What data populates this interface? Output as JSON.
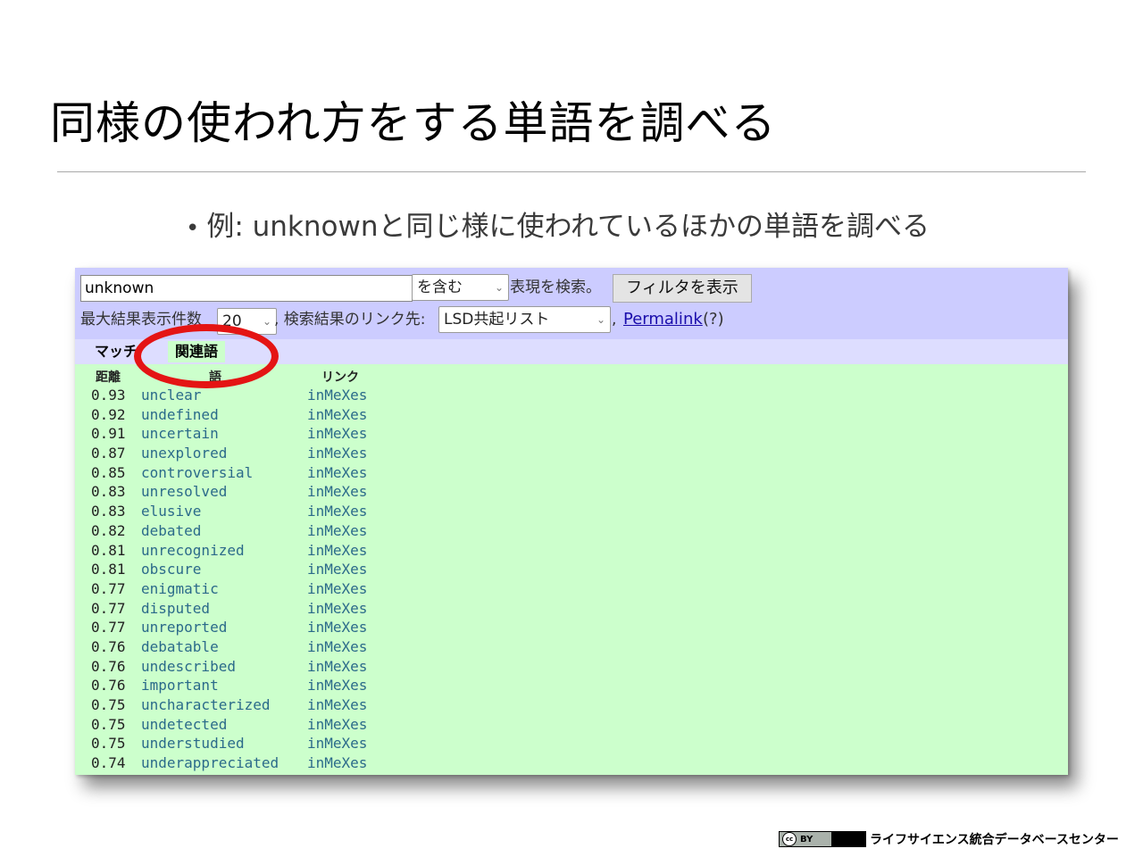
{
  "slide": {
    "title": "同様の使われ方をする単語を調べる",
    "bullet_dot": "•",
    "bullet": "例: unknownと同じ様に使われているほかの単語を調べる"
  },
  "toolbar": {
    "search_value": "unknown",
    "match_mode": "を含む",
    "search_suffix": "表現を検索。",
    "filter_button": "フィルタを表示",
    "max_results_label": "最大結果表示件数",
    "max_results_value": "20",
    "link_target_label": ", 検索結果のリンク先:",
    "link_target_value": "LSD共起リスト",
    "comma": ",",
    "permalink": "Permalink",
    "help": "(?)"
  },
  "tabs": {
    "match": "マッチ",
    "related": "関連語"
  },
  "results": {
    "headers": {
      "distance": "距離",
      "word": "語",
      "link": "リンク"
    },
    "rows": [
      {
        "score": "0.93",
        "word": "unclear",
        "link": "inMeXes"
      },
      {
        "score": "0.92",
        "word": "undefined",
        "link": "inMeXes"
      },
      {
        "score": "0.91",
        "word": "uncertain",
        "link": "inMeXes"
      },
      {
        "score": "0.87",
        "word": "unexplored",
        "link": "inMeXes"
      },
      {
        "score": "0.85",
        "word": "controversial",
        "link": "inMeXes"
      },
      {
        "score": "0.83",
        "word": "unresolved",
        "link": "inMeXes"
      },
      {
        "score": "0.83",
        "word": "elusive",
        "link": "inMeXes"
      },
      {
        "score": "0.82",
        "word": "debated",
        "link": "inMeXes"
      },
      {
        "score": "0.81",
        "word": "unrecognized",
        "link": "inMeXes"
      },
      {
        "score": "0.81",
        "word": "obscure",
        "link": "inMeXes"
      },
      {
        "score": "0.77",
        "word": "enigmatic",
        "link": "inMeXes"
      },
      {
        "score": "0.77",
        "word": "disputed",
        "link": "inMeXes"
      },
      {
        "score": "0.77",
        "word": "unreported",
        "link": "inMeXes"
      },
      {
        "score": "0.76",
        "word": "debatable",
        "link": "inMeXes"
      },
      {
        "score": "0.76",
        "word": "undescribed",
        "link": "inMeXes"
      },
      {
        "score": "0.76",
        "word": "important",
        "link": "inMeXes"
      },
      {
        "score": "0.75",
        "word": "uncharacterized",
        "link": "inMeXes"
      },
      {
        "score": "0.75",
        "word": "undetected",
        "link": "inMeXes"
      },
      {
        "score": "0.75",
        "word": "understudied",
        "link": "inMeXes"
      },
      {
        "score": "0.74",
        "word": "underappreciated",
        "link": "inMeXes"
      }
    ]
  },
  "footer": {
    "cc_symbol": "cc",
    "cc_license": "BY",
    "organization": "ライフサイエンス統合データベースセンター"
  },
  "colors": {
    "toolbar_bg": "#ccccff",
    "tabbar_bg": "#ddddff",
    "results_bg": "#ccffcc",
    "highlight_ring": "#e41414",
    "link_color": "#1a0dab",
    "word_color": "#2b6a8a"
  },
  "icons": {
    "select_arrow": "chevron-down-icon"
  }
}
